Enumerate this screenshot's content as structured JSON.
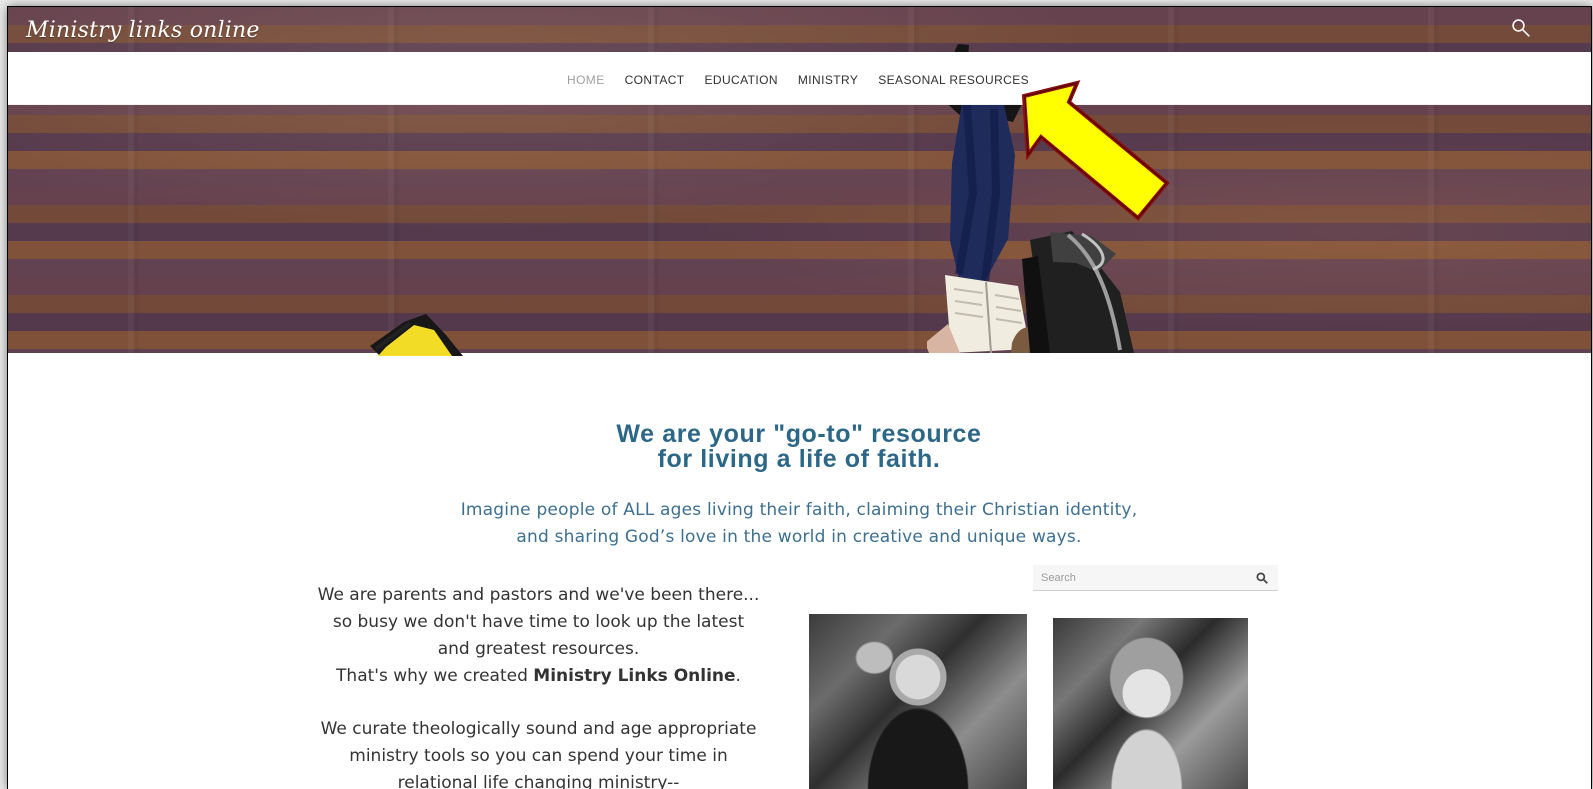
{
  "site": {
    "title": "Ministry links online",
    "search_icon": "search-icon"
  },
  "navigation": {
    "items": [
      {
        "label": "HOME",
        "active": true
      },
      {
        "label": "CONTACT",
        "active": false
      },
      {
        "label": "EDUCATION",
        "active": false
      },
      {
        "label": "MINISTRY",
        "active": false
      },
      {
        "label": "SEASONAL RESOURCES",
        "active": false
      }
    ]
  },
  "hero": {
    "headline_lines": [
      {
        "prefix": "We are your \"",
        "bold": "go-to\" resource",
        "suffix": ""
      },
      {
        "text": "for living a life of faith."
      }
    ],
    "subheadline_lines": [
      "Imagine people of ALL ages living their faith, claiming their Christian identity,",
      "and sharing God’s love in the world in creative and unique ways."
    ]
  },
  "body": {
    "paragraphs": [
      "We are parents and pastors and we've been there...",
      "so busy we don't have time to look up the latest",
      "and greatest resources.",
      "That's why we created ",
      "Ministry Links Online",
      ".",
      "We curate theologically sound and age appropriate",
      "ministry tools so you can spend your time in",
      "relational life changing ministry--"
    ]
  },
  "sidebar": {
    "search_placeholder": "Search",
    "search_button_icon": "search-icon"
  },
  "colors": {
    "headline": "#2d6788",
    "subheadline": "#3d6f8f",
    "annotation_arrow": "#ffff00",
    "annotation_outline": "#8b1010"
  }
}
